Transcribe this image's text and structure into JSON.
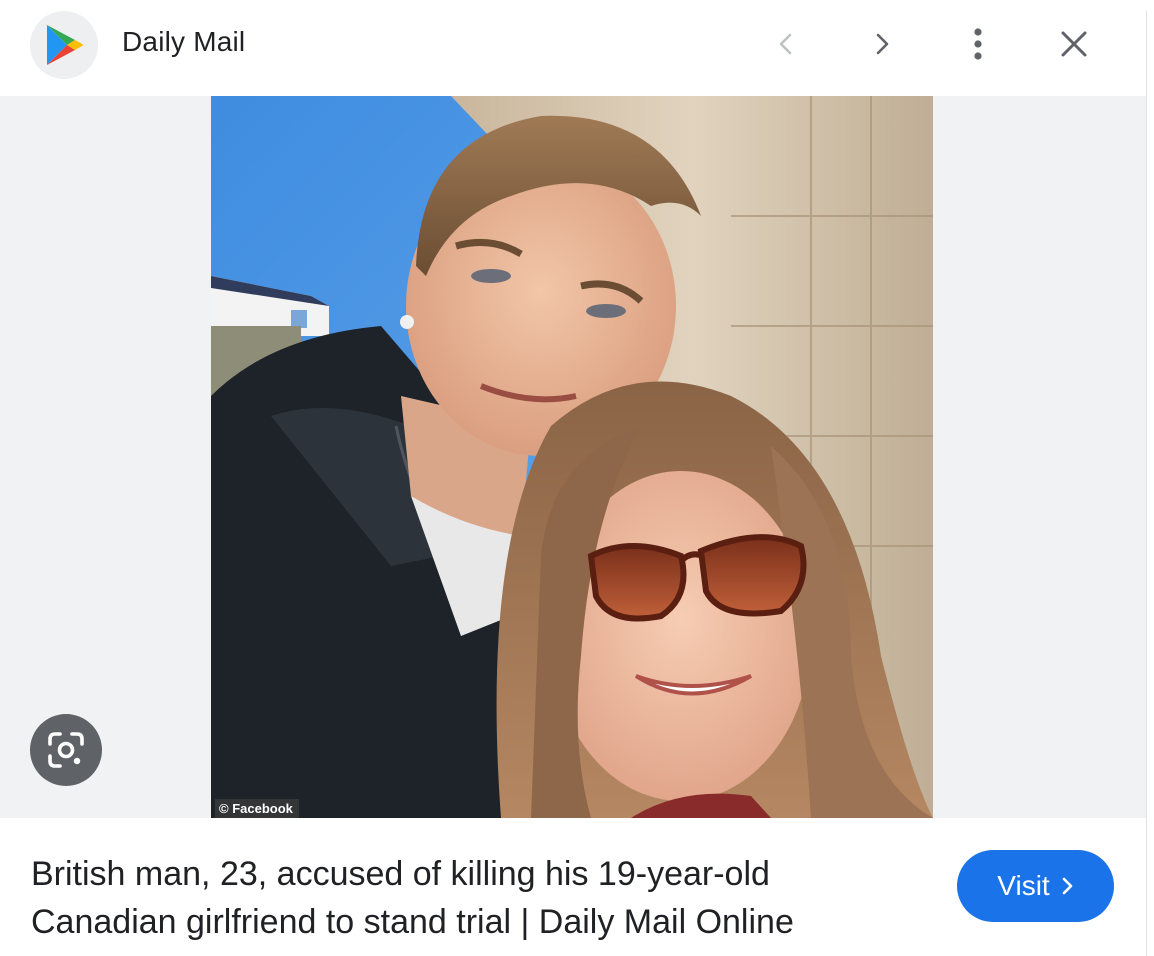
{
  "header": {
    "source_name": "Daily Mail",
    "icons": {
      "favicon": "google-play-icon",
      "back": "chevron-left-icon",
      "forward": "chevron-right-icon",
      "more": "more-vert-icon",
      "close": "close-icon"
    }
  },
  "image": {
    "credit": "© Facebook",
    "lens_icon": "google-lens-icon"
  },
  "result": {
    "title_line1": "British man, 23, accused of killing his 19-year-old",
    "title_line2": "Canadian girlfriend to stand trial | Daily Mail Online",
    "visit_label": "Visit",
    "visit_icon": "chevron-right-icon"
  },
  "colors": {
    "accent": "#1a73e8",
    "text": "#202124",
    "icon_gray": "#5f6368",
    "icon_disabled": "#bdc1c6"
  }
}
